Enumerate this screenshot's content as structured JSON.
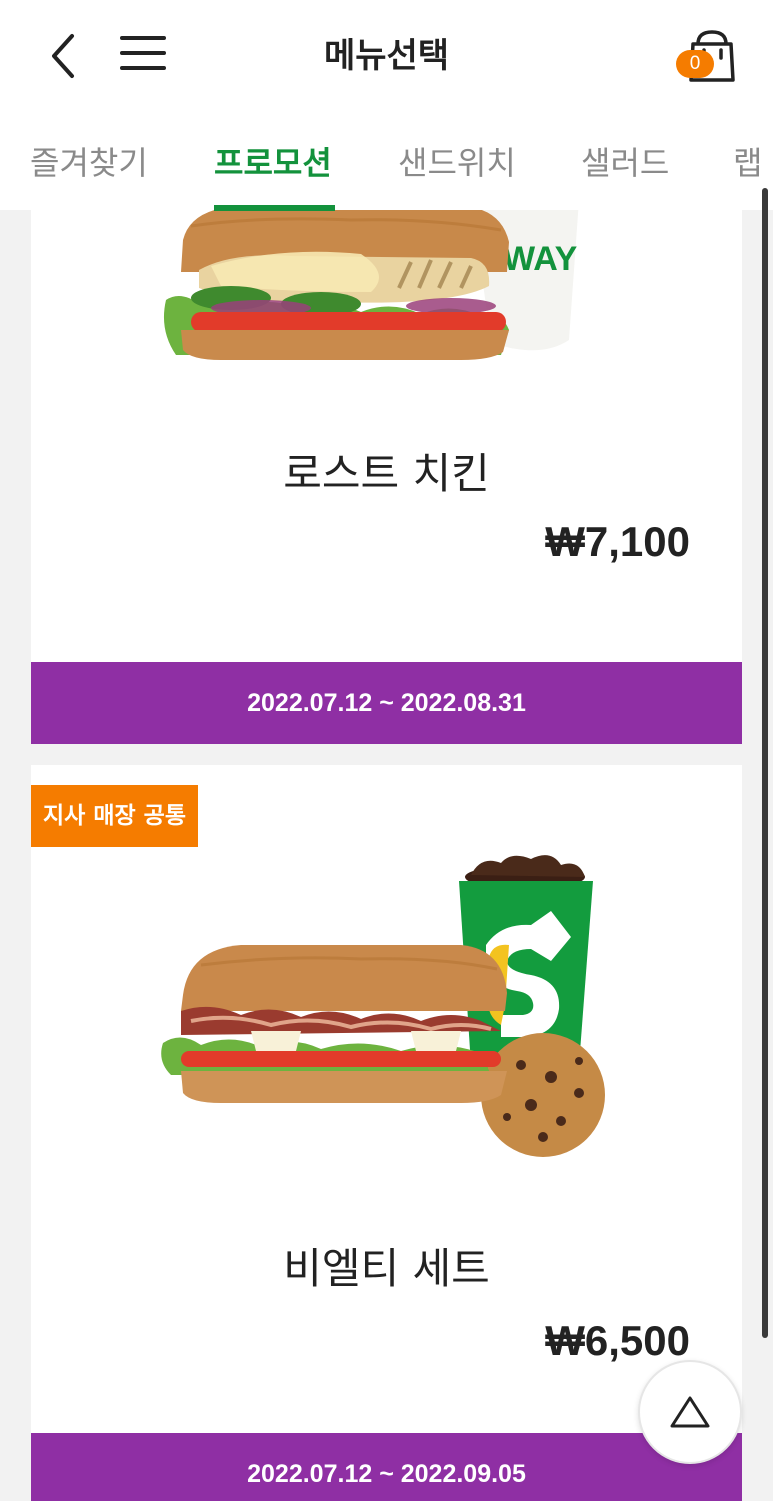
{
  "header": {
    "title": "메뉴선택",
    "cart_count": "0"
  },
  "tabs": [
    {
      "label": "즐겨찾기",
      "active": false
    },
    {
      "label": "프로모션",
      "active": true
    },
    {
      "label": "샌드위치",
      "active": false
    },
    {
      "label": "샐러드",
      "active": false
    },
    {
      "label": "랩",
      "active": false
    }
  ],
  "products": [
    {
      "name": "로스트 치킨",
      "price": "₩7,100",
      "period": "2022.07.12 ~ 2022.08.31",
      "image": "roast-chicken-sandwich-with-drink"
    },
    {
      "badge": "지사 매장 공통",
      "name": "비엘티 세트",
      "price": "₩6,500",
      "period": "2022.07.12 ~ 2022.09.05",
      "image": "blt-sandwich-with-drink-and-cookie"
    }
  ],
  "icons": {
    "back": "chevron-left-icon",
    "menu": "hamburger-menu-icon",
    "cart": "shopping-bag-icon",
    "scroll_top": "triangle-up-icon"
  },
  "colors": {
    "accent_green": "#13923c",
    "period_purple": "#8f2fa4",
    "badge_orange": "#f57c00"
  }
}
